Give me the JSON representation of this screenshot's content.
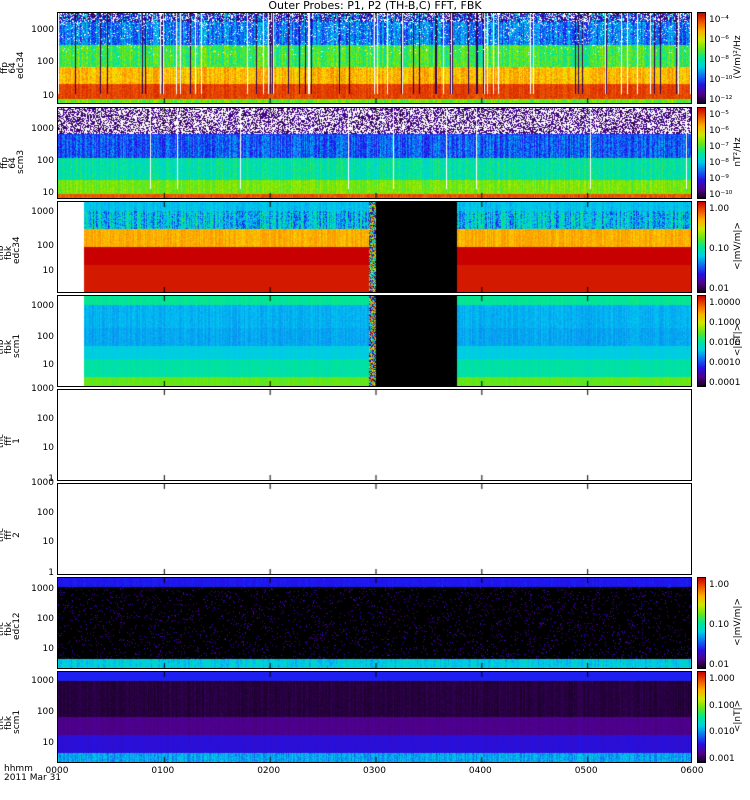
{
  "title": "Outer Probes: P1, P2 (TH-B,C) FFT, FBK",
  "chart_data": {
    "type": "heatmap",
    "title": "Outer Probes: P1, P2 (TH-B,C) FFT, FBK",
    "xlabel": "hhmm",
    "date": "2011 Mar 31",
    "x_ticks": [
      "0000",
      "0100",
      "0200",
      "0300",
      "0400",
      "0500",
      "0600"
    ],
    "x_range_hours": [
      0,
      6
    ],
    "panels": [
      {
        "label": [
          "thb",
          "ffp",
          "64",
          "edc34"
        ],
        "y_ticks": [
          "1000",
          "100",
          "10"
        ],
        "ylim": [
          8,
          4096
        ],
        "colorbar_ticks": [
          "10⁻⁴",
          "10⁻⁶",
          "10⁻⁸",
          "10⁻¹⁰",
          "10⁻¹²"
        ],
        "colorbar_unit": "(V/m)²/Hz"
      },
      {
        "label": [
          "thb",
          "ffp",
          "64",
          "scm3"
        ],
        "y_ticks": [
          "1000",
          "100",
          "10"
        ],
        "ylim": [
          8,
          4096
        ],
        "colorbar_ticks": [
          "10⁻⁵",
          "10⁻⁶",
          "10⁻⁷",
          "10⁻⁸",
          "10⁻⁹",
          "10⁻¹⁰"
        ],
        "colorbar_unit": "nT²/Hz"
      },
      {
        "label": [
          "thb",
          "fbk",
          "edc34"
        ],
        "y_ticks": [
          "1000",
          "100",
          "10"
        ],
        "ylim": [
          2,
          2048
        ],
        "colorbar_ticks": [
          "1.00",
          "0.10",
          "0.01"
        ],
        "colorbar_unit": "<|mV/m|>"
      },
      {
        "label": [
          "thb",
          "fbk",
          "scm1"
        ],
        "y_ticks": [
          "1000",
          "100",
          "10"
        ],
        "ylim": [
          2,
          2048
        ],
        "colorbar_ticks": [
          "1.0000",
          "0.1000",
          "0.0100",
          "0.0010",
          "0.0001"
        ],
        "colorbar_unit": "<|nT|>"
      },
      {
        "label": [
          "thc",
          "fff",
          "1"
        ],
        "y_ticks": [
          "1000",
          "100",
          "10",
          "1"
        ],
        "ylim": [
          1,
          1000
        ],
        "colorbar_ticks": [],
        "colorbar_unit": ""
      },
      {
        "label": [
          "thc",
          "fff",
          "2"
        ],
        "y_ticks": [
          "1000",
          "100",
          "10",
          "1"
        ],
        "ylim": [
          1,
          1000
        ],
        "colorbar_ticks": [],
        "colorbar_unit": ""
      },
      {
        "label": [
          "thc",
          "fbk",
          "edc12"
        ],
        "y_ticks": [
          "1000",
          "100",
          "10"
        ],
        "ylim": [
          2,
          2048
        ],
        "colorbar_ticks": [
          "1.00",
          "0.10",
          "0.01"
        ],
        "colorbar_unit": "<|mV/m|>"
      },
      {
        "label": [
          "thc",
          "fbk",
          "scm1"
        ],
        "y_ticks": [
          "1000",
          "100",
          "10"
        ],
        "ylim": [
          2,
          2048
        ],
        "colorbar_ticks": [
          "1.000",
          "0.100",
          "0.010",
          "0.001"
        ],
        "colorbar_unit": "<|nT|>"
      }
    ]
  }
}
